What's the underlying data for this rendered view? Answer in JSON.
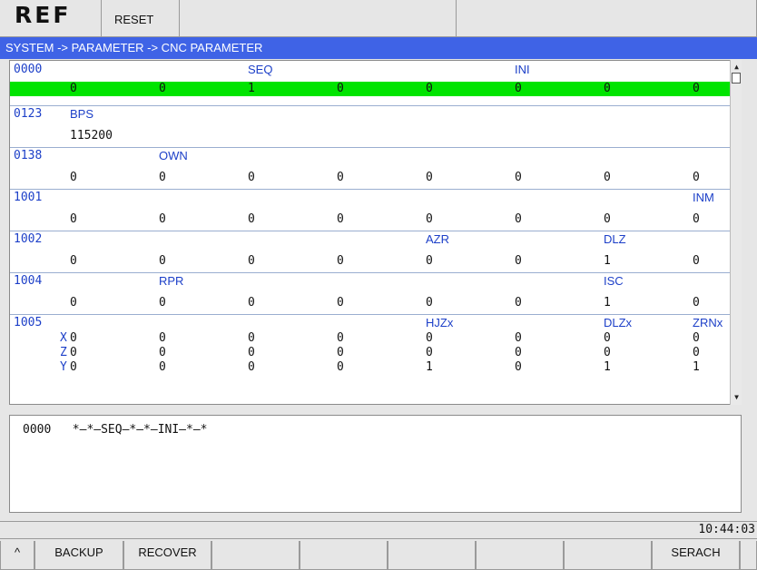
{
  "header": {
    "mode": "REF",
    "reset": "RESET"
  },
  "breadcrumb": "SYSTEM -> PARAMETER -> CNC PARAMETER",
  "params": [
    {
      "num": "0000",
      "labels": {
        "3": "SEQ",
        "6": "INI"
      },
      "values": [
        "0",
        "0",
        "1",
        "0",
        "0",
        "0",
        "0",
        "0"
      ]
    },
    {
      "num": "0123",
      "labels": {
        "1": "BPS"
      },
      "values": [
        "115200"
      ]
    },
    {
      "num": "0138",
      "labels": {
        "2": "OWN"
      },
      "values": [
        "0",
        "0",
        "0",
        "0",
        "0",
        "0",
        "0",
        "0"
      ]
    },
    {
      "num": "1001",
      "labels": {
        "8": "INM"
      },
      "values": [
        "0",
        "0",
        "0",
        "0",
        "0",
        "0",
        "0",
        "0"
      ]
    },
    {
      "num": "1002",
      "labels": {
        "5": "AZR",
        "7": "DLZ"
      },
      "values": [
        "0",
        "0",
        "0",
        "0",
        "0",
        "0",
        "1",
        "0"
      ]
    },
    {
      "num": "1004",
      "labels": {
        "2": "RPR",
        "7": "ISC"
      },
      "values": [
        "0",
        "0",
        "0",
        "0",
        "0",
        "0",
        "1",
        "0"
      ]
    },
    {
      "num": "1005",
      "labels": {
        "5": "HJZx",
        "7": "DLZx",
        "8": "ZRNx"
      },
      "axes": [
        {
          "name": "X",
          "values": [
            "0",
            "0",
            "0",
            "0",
            "0",
            "0",
            "0",
            "0"
          ]
        },
        {
          "name": "Z",
          "values": [
            "0",
            "0",
            "0",
            "0",
            "0",
            "0",
            "0",
            "0"
          ]
        },
        {
          "name": "Y",
          "values": [
            "0",
            "0",
            "0",
            "0",
            "1",
            "0",
            "1",
            "1"
          ]
        }
      ]
    }
  ],
  "info_line": "0000   *—*—SEQ—*—*—INI—*—*",
  "time": "10:44:03",
  "softkeys": [
    "^",
    "BACKUP",
    "RECOVER",
    "",
    "",
    "",
    "",
    "",
    "SERACH",
    ""
  ]
}
